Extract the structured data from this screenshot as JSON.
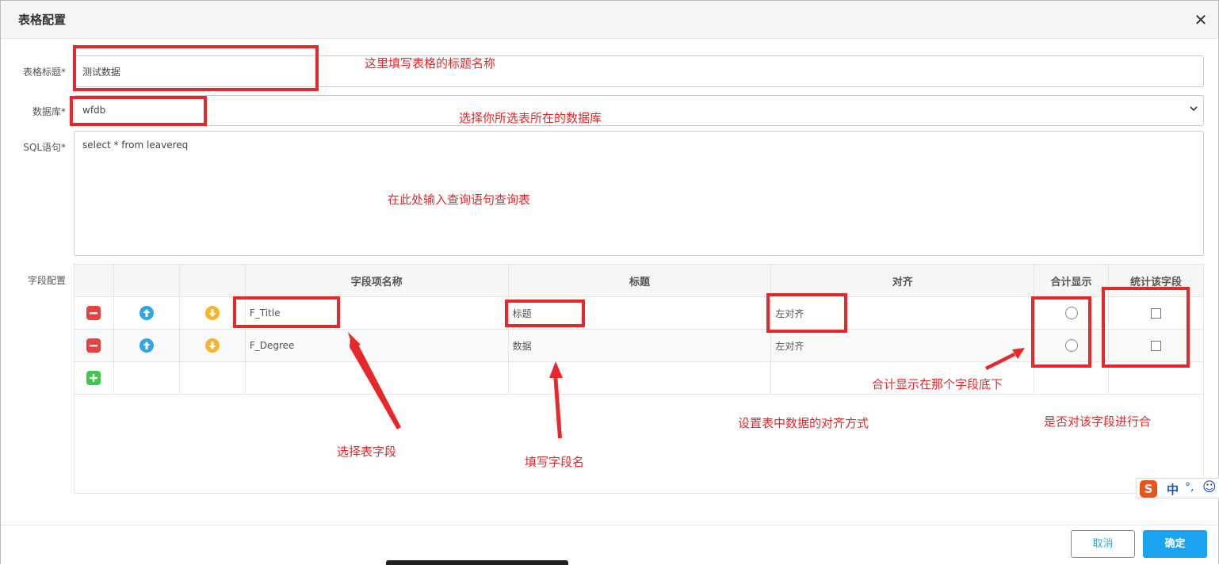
{
  "dialog": {
    "title": "表格配置",
    "close_glyph": "✕"
  },
  "form": {
    "title_label": "表格标题*",
    "title_value": "测试数据",
    "db_label": "数据库*",
    "db_value": "wfdb",
    "sql_label": "SQL语句*",
    "sql_value": "select * from leavereq",
    "fields_label": "字段配置"
  },
  "table": {
    "headers": [
      "",
      "",
      "",
      "字段项名称",
      "标题",
      "对齐",
      "合计显示",
      "统计该字段"
    ],
    "rows": [
      {
        "field": "F_Title",
        "title": "标题",
        "align": "左对齐"
      },
      {
        "field": "F_Degree",
        "title": "数据",
        "align": "左对齐"
      }
    ]
  },
  "annotations": {
    "title_hint": "这里填写表格的标题名称",
    "db_hint": "选择你所选表所在的数据库",
    "sql_hint": "在此处输入查询语句查询表",
    "field_hint": "选择表字段",
    "title_col_hint": "填写字段名",
    "align_hint": "设置表中数据的对齐方式",
    "sum_hint": "合计显示在那个字段底下",
    "stat_hint": "是否对该字段进行合"
  },
  "ime": {
    "lang": "中",
    "punct": "°,",
    "emoji": "☺"
  },
  "footer": {
    "cancel": "取消",
    "ok": "确定"
  },
  "colors": {
    "accent": "#1aa3f0",
    "annotation": "#e8272a"
  }
}
